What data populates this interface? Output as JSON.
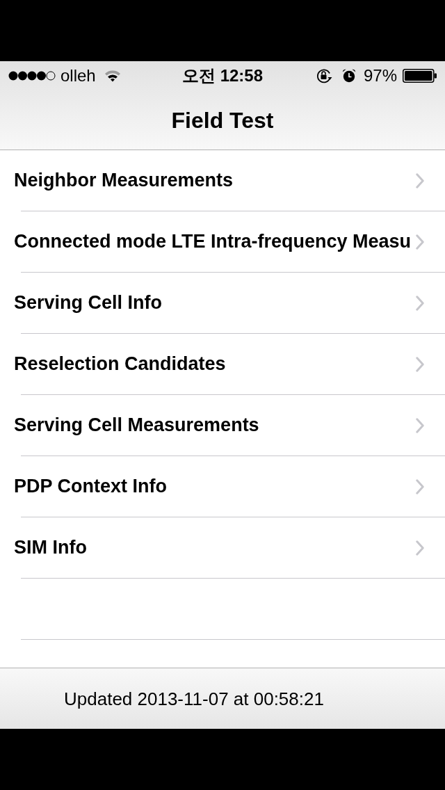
{
  "status_bar": {
    "carrier": "olleh",
    "time": "오전 12:58",
    "battery": "97%"
  },
  "nav_bar": {
    "title": "Field Test"
  },
  "menu": {
    "items": [
      {
        "label": "Neighbor Measurements"
      },
      {
        "label": "Connected mode LTE Intra-frequency Measu"
      },
      {
        "label": "Serving Cell Info"
      },
      {
        "label": "Reselection Candidates"
      },
      {
        "label": "Serving Cell Measurements"
      },
      {
        "label": "PDP Context Info"
      },
      {
        "label": "SIM Info"
      }
    ]
  },
  "footer": {
    "text": "Updated 2013-11-07 at 00:58:21"
  }
}
